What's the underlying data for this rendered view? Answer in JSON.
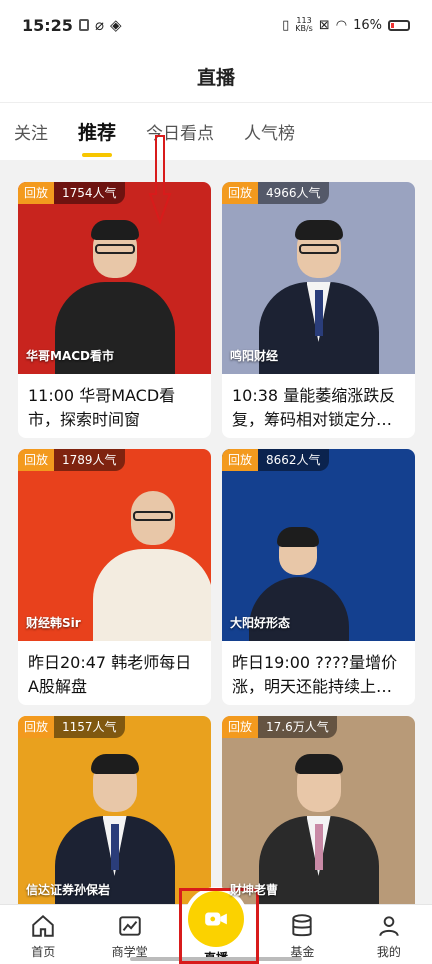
{
  "status": {
    "time": "15:25",
    "net_speed_value": "113",
    "net_speed_unit": "KB/s",
    "battery": "16%"
  },
  "header": {
    "title": "直播"
  },
  "tabs": [
    {
      "label": "关注",
      "active": false
    },
    {
      "label": "推荐",
      "active": true
    },
    {
      "label": "今日看点",
      "active": false
    },
    {
      "label": "人气榜",
      "active": false
    }
  ],
  "cards": [
    {
      "badge": "回放",
      "popularity": "1754人气",
      "host": "华哥MACD看市",
      "title": "11:00 华哥MACD看市，探索时间窗",
      "bg": "#c8241e"
    },
    {
      "badge": "回放",
      "popularity": "4966人气",
      "host": "鸣阳财经",
      "title": "10:38 量能萎缩涨跌反复，筹码相对锁定分…",
      "bg": "#9aa3c0"
    },
    {
      "badge": "回放",
      "popularity": "1789人气",
      "host": "财经韩Sir",
      "title": "昨日20:47 韩老师每日A股解盘",
      "bg": "#e8411c"
    },
    {
      "badge": "回放",
      "popularity": "8662人气",
      "host": "大阳好形态",
      "title": "昨日19:00 ????量增价涨，明天还能持续上…",
      "bg": "#14408f"
    },
    {
      "badge": "回放",
      "popularity": "1157人气",
      "host": "信达证券孙保岩",
      "title": "",
      "bg": "#e9a11e"
    },
    {
      "badge": "回放",
      "popularity": "17.6万人气",
      "host": "财坤老曹",
      "title": "",
      "bg": "#b89a78"
    }
  ],
  "nav": [
    {
      "label": "首页",
      "icon": "home-icon"
    },
    {
      "label": "商学堂",
      "icon": "chart-icon"
    },
    {
      "label": "直播",
      "icon": "video-icon"
    },
    {
      "label": "基金",
      "icon": "database-icon"
    },
    {
      "label": "我的",
      "icon": "user-icon"
    }
  ],
  "accent": "#f7c600"
}
